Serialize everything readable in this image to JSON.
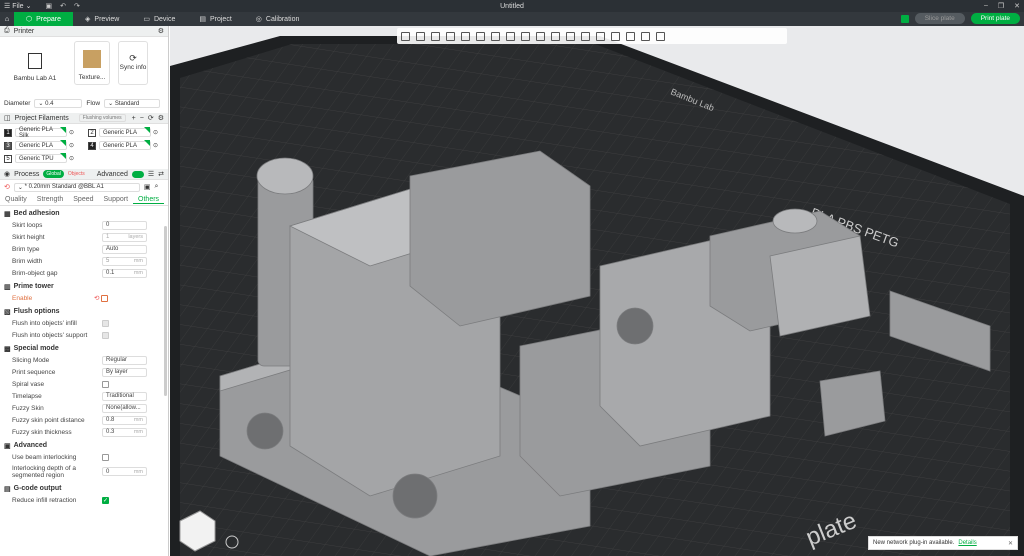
{
  "window": {
    "title": "Untitled",
    "file_label": "File"
  },
  "tabs": [
    {
      "label": "Prepare"
    },
    {
      "label": "Preview"
    },
    {
      "label": "Device"
    },
    {
      "label": "Project"
    },
    {
      "label": "Calibration"
    }
  ],
  "actions": {
    "slice_label": "Slice plate",
    "print_label": "Print plate"
  },
  "printer": {
    "section_title": "Printer",
    "model": "Bambu Lab A1",
    "plate": "Texture...",
    "sync_label": "Sync info",
    "diameter_label": "Diameter",
    "diameter_value": "0.4",
    "flow_label": "Flow",
    "flow_value": "Standard"
  },
  "filaments": {
    "section_title": "Project Filaments",
    "flushing_label": "Flushing volumes",
    "items": [
      {
        "num": "1",
        "name": "Generic PLA Silk"
      },
      {
        "num": "2",
        "name": "Generic PLA"
      },
      {
        "num": "3",
        "name": "Generic PLA"
      },
      {
        "num": "4",
        "name": "Generic PLA"
      },
      {
        "num": "5",
        "name": "Generic TPU"
      }
    ]
  },
  "process": {
    "section_title": "Process",
    "global_label": "Global",
    "objects_label": "Objects",
    "advanced_label": "Advanced",
    "preset": "* 0.20mm Standard @BBL A1",
    "subtabs": [
      "Quality",
      "Strength",
      "Speed",
      "Support",
      "Others"
    ],
    "bed_adhesion": {
      "title": "Bed adhesion",
      "skirt_loops": {
        "label": "Skirt loops",
        "value": "0"
      },
      "skirt_height": {
        "label": "Skirt height",
        "value": "1",
        "unit": "layers"
      },
      "brim_type": {
        "label": "Brim type",
        "value": "Auto"
      },
      "brim_width": {
        "label": "Brim width",
        "value": "5",
        "unit": "mm"
      },
      "brim_gap": {
        "label": "Brim-object gap",
        "value": "0.1",
        "unit": "mm"
      }
    },
    "prime_tower": {
      "title": "Prime tower",
      "enable_label": "Enable"
    },
    "flush": {
      "title": "Flush options",
      "infill_label": "Flush into objects' infill",
      "support_label": "Flush into objects' support"
    },
    "special": {
      "title": "Special mode",
      "slicing_mode": {
        "label": "Slicing Mode",
        "value": "Regular"
      },
      "print_sequence": {
        "label": "Print sequence",
        "value": "By layer"
      },
      "spiral_label": "Spiral vase",
      "timelapse": {
        "label": "Timelapse",
        "value": "Traditional"
      },
      "fuzzy_skin": {
        "label": "Fuzzy Skin",
        "value": "None(allow..."
      },
      "fuzzy_dist": {
        "label": "Fuzzy skin point distance",
        "value": "0.8",
        "unit": "mm"
      },
      "fuzzy_thick": {
        "label": "Fuzzy skin thickness",
        "value": "0.3",
        "unit": "mm"
      }
    },
    "advanced": {
      "title": "Advanced",
      "beam_label": "Use beam interlocking",
      "depth_label_1": "Interlocking depth of a",
      "depth_label_2": "segmented region",
      "depth_value": "0",
      "depth_unit": "mm"
    },
    "gcode": {
      "title": "G-code output",
      "reduce_label": "Reduce infill retraction"
    }
  },
  "plate": {
    "label": "plate",
    "material_text": "PLA PBS PETG",
    "brand_text": "Bambu Lab"
  },
  "notice": {
    "text": "New network plug-in available.",
    "link": "Details"
  },
  "colors": {
    "accent": "#00ae42",
    "dark": "#2b3035"
  }
}
